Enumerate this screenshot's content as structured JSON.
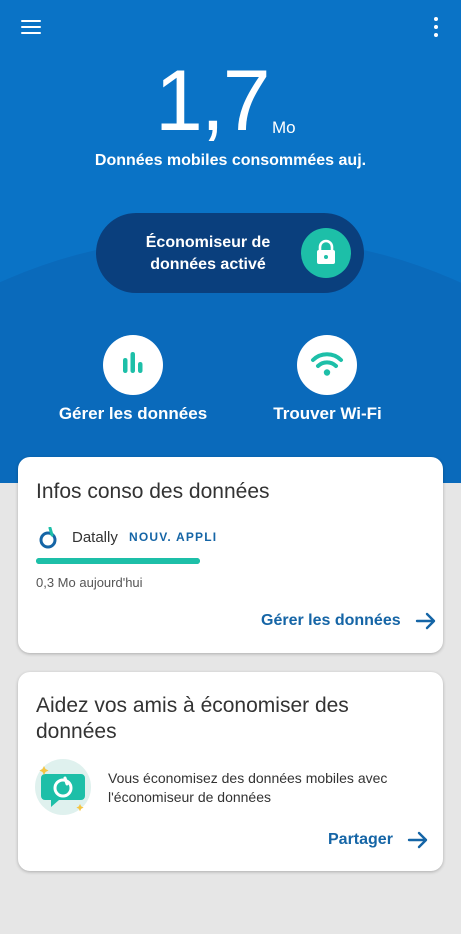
{
  "header": {
    "usage_value": "1,7",
    "usage_unit": "Mo",
    "usage_caption": "Données mobiles consommées auj.",
    "menu_icon": "menu-icon",
    "more_icon": "more-vert-icon"
  },
  "saver": {
    "label": "Économiseur de données activé",
    "icon": "lock-icon"
  },
  "quick_actions": [
    {
      "label": "Gérer les données",
      "icon": "bar-chart-icon"
    },
    {
      "label": "Trouver Wi-Fi",
      "icon": "wifi-icon"
    }
  ],
  "info_card": {
    "title": "Infos conso des données",
    "app_name": "Datally",
    "app_badge": "NOUV. APPLI",
    "usage_fraction": 1.0,
    "usage_text": "0,3 Mo aujourd'hui",
    "action_label": "Gérer les données"
  },
  "share_card": {
    "title": "Aidez vos amis à économiser des données",
    "body": "Vous économisez des données mobiles avec l'économiseur de données",
    "action_label": "Partager"
  },
  "colors": {
    "primary_blue": "#0a73c6",
    "pill_dark_blue": "#0a3f7d",
    "teal": "#1dbfa8",
    "link_blue": "#1565a6",
    "background_grey": "#e6e6e6"
  }
}
